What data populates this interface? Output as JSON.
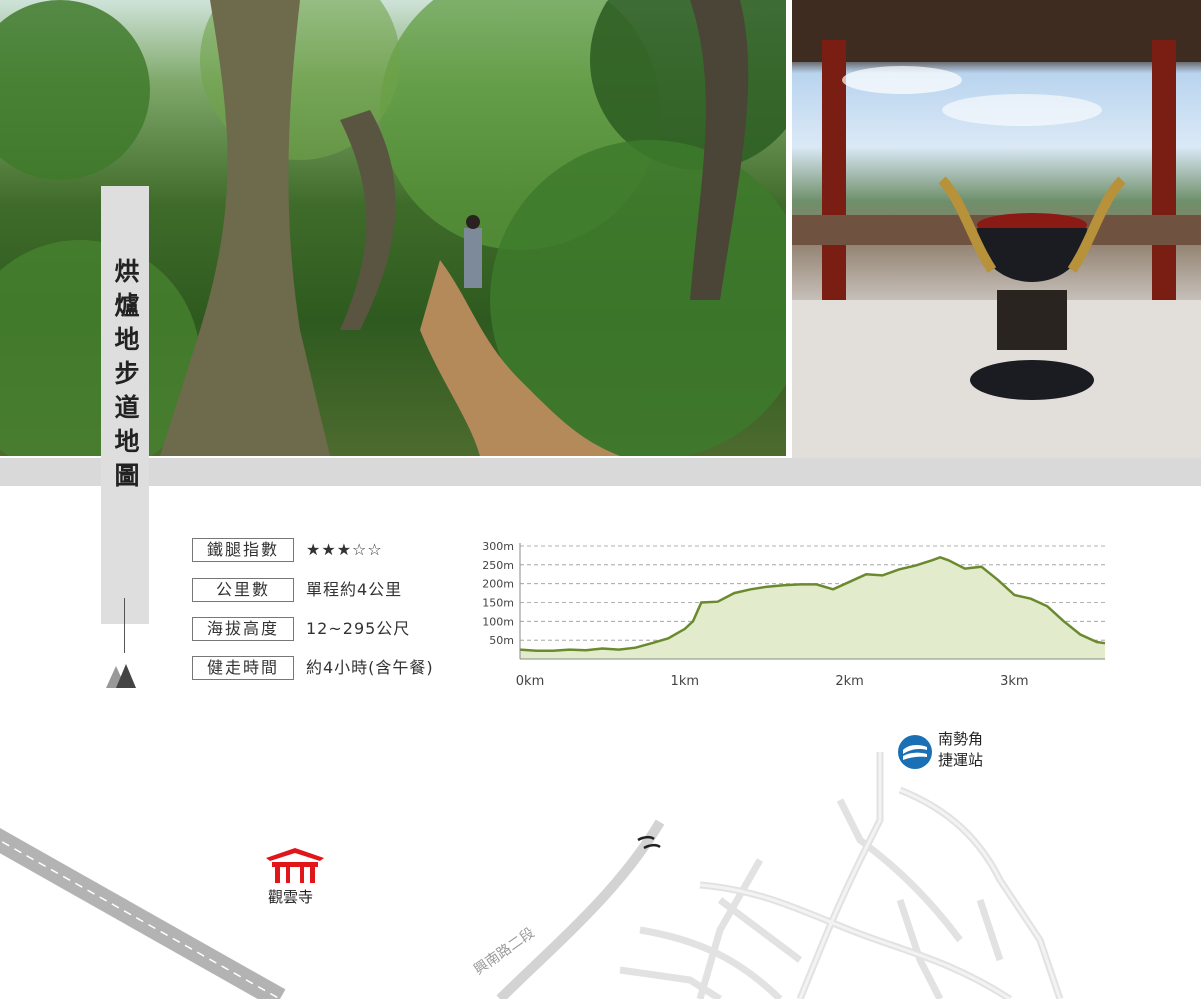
{
  "title": "烘爐地步道地圖",
  "stats": [
    {
      "label": "鐵腿指數",
      "value": "★★★☆☆"
    },
    {
      "label": "公里數",
      "value": "單程約4公里"
    },
    {
      "label": "海拔高度",
      "value": "12~295公尺"
    },
    {
      "label": "健走時間",
      "value": "約4小時(含午餐)"
    }
  ],
  "chart_data": {
    "type": "area",
    "title": "",
    "xlabel": "",
    "ylabel": "",
    "x_ticks": [
      "0km",
      "1km",
      "2km",
      "3km"
    ],
    "y_ticks": [
      "300m",
      "250m",
      "200m",
      "150m",
      "100m",
      "50m"
    ],
    "xlim": [
      0,
      3.55
    ],
    "ylim": [
      0,
      300
    ],
    "grid": true,
    "fill_color": "#e3ebcd",
    "line_color": "#6b8a2e",
    "x": [
      0,
      0.1,
      0.2,
      0.3,
      0.4,
      0.5,
      0.6,
      0.7,
      0.8,
      0.9,
      1.0,
      1.05,
      1.1,
      1.2,
      1.3,
      1.4,
      1.5,
      1.6,
      1.7,
      1.8,
      1.9,
      2.0,
      2.1,
      2.2,
      2.3,
      2.4,
      2.5,
      2.55,
      2.6,
      2.7,
      2.8,
      2.9,
      3.0,
      3.1,
      3.2,
      3.3,
      3.4,
      3.5,
      3.55
    ],
    "y": [
      25,
      22,
      22,
      25,
      23,
      28,
      25,
      30,
      42,
      55,
      80,
      100,
      150,
      152,
      175,
      185,
      192,
      196,
      198,
      198,
      185,
      205,
      225,
      222,
      238,
      248,
      262,
      270,
      262,
      240,
      245,
      210,
      170,
      160,
      140,
      100,
      65,
      45,
      42
    ]
  },
  "map": {
    "temple_label": "觀雲寺",
    "mrt_label_line1": "南勢角",
    "mrt_label_line2": "捷運站",
    "road_label": "興南路二段"
  },
  "colors": {
    "temple_icon": "#e0161b",
    "mrt_icon": "#1a6fb5"
  },
  "icons": {
    "temple": "temple-gate-icon",
    "mrt": "mrt-logo-icon",
    "terrain": "mountain-icon"
  }
}
